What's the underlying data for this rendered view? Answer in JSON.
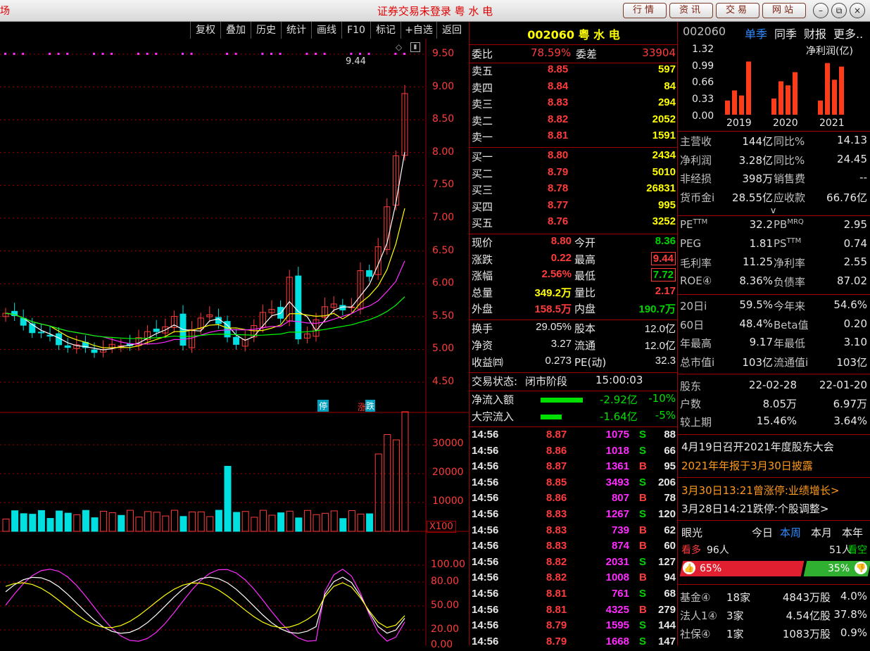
{
  "titlebar": {
    "left_fragment": "场",
    "title": "证券交易未登录 粤 水 电",
    "buttons": [
      "行情",
      "资讯",
      "交易",
      "网站"
    ],
    "win_min": "–",
    "win_restore": "⧉",
    "win_close": "×"
  },
  "toolbar": {
    "items": [
      "复权",
      "叠加",
      "历史",
      "统计",
      "画线",
      "F10",
      "标记",
      "+自选",
      "返回"
    ]
  },
  "kline": {
    "price_axis": [
      "9.50",
      "9.00",
      "8.50",
      "8.00",
      "7.50",
      "7.00",
      "6.50",
      "6.00",
      "5.50",
      "5.00",
      "4.50"
    ],
    "high_label": "9.44",
    "badge_stop": "停",
    "badge_limit_down": "跌"
  },
  "volume": {
    "axis": [
      "30000",
      "20000",
      "10000"
    ],
    "unit": "X100"
  },
  "indicator": {
    "axis": [
      "100.00",
      "80.00",
      "50.00",
      "20.00",
      "0.00"
    ]
  },
  "quote": {
    "code": "002060",
    "name": "粤 水 电",
    "weibi_label": "委比",
    "weibi": "78.59%",
    "weicha_label": "委差",
    "weicha": "33904",
    "sell": [
      {
        "label": "卖五",
        "price": "8.85",
        "vol": "597"
      },
      {
        "label": "卖四",
        "price": "8.84",
        "vol": "84"
      },
      {
        "label": "卖三",
        "price": "8.83",
        "vol": "294"
      },
      {
        "label": "卖二",
        "price": "8.82",
        "vol": "2052"
      },
      {
        "label": "卖一",
        "price": "8.81",
        "vol": "1591"
      }
    ],
    "buy": [
      {
        "label": "买一",
        "price": "8.80",
        "vol": "2434"
      },
      {
        "label": "买二",
        "price": "8.79",
        "vol": "5010"
      },
      {
        "label": "买三",
        "price": "8.78",
        "vol": "26831"
      },
      {
        "label": "买四",
        "price": "8.77",
        "vol": "995"
      },
      {
        "label": "买五",
        "price": "8.76",
        "vol": "3252"
      }
    ],
    "stats": [
      {
        "l1": "现价",
        "v1": "8.80",
        "l2": "今开",
        "v2": "8.36",
        "c1": "red",
        "c2": "green",
        "box": false
      },
      {
        "l1": "涨跌",
        "v1": "0.22",
        "l2": "最高",
        "v2": "9.44",
        "c1": "red",
        "c2": "red",
        "box": true
      },
      {
        "l1": "涨幅",
        "v1": "2.56%",
        "l2": "最低",
        "v2": "7.72",
        "c1": "red",
        "c2": "green",
        "box": true
      },
      {
        "l1": "总量",
        "v1": "349.2万",
        "l2": "量比",
        "v2": "2.17",
        "c1": "yellow",
        "c2": "red",
        "box": false
      },
      {
        "l1": "外盘",
        "v1": "158.5万",
        "l2": "内盘",
        "v2": "190.7万",
        "c1": "red",
        "c2": "green",
        "box": false
      }
    ],
    "stats2": [
      {
        "l1": "换手",
        "v1": "29.05%",
        "l2": "股本",
        "v2": "12.0亿"
      },
      {
        "l1": "净资",
        "v1": "3.27",
        "l2": "流通",
        "v2": "12.0亿"
      },
      {
        "l1": "收益㈣",
        "v1": "0.273",
        "l2": "PE(动)",
        "v2": "32.3"
      }
    ],
    "status_label": "交易状态:",
    "status": "闭市阶段",
    "status_time": "15:00:03",
    "flow": [
      {
        "label": "净流入额",
        "value": "-2.92亿",
        "pct": "-10%",
        "bar": 0.1
      },
      {
        "label": "大宗流入",
        "value": "-1.64亿",
        "pct": "-5%",
        "bar": 0.05
      }
    ],
    "ticks": [
      {
        "t": "14:56",
        "p": "8.87",
        "v": "1075",
        "d": "S",
        "n": "88"
      },
      {
        "t": "14:56",
        "p": "8.86",
        "v": "1018",
        "d": "S",
        "n": "66"
      },
      {
        "t": "14:56",
        "p": "8.87",
        "v": "1361",
        "d": "B",
        "n": "95"
      },
      {
        "t": "14:56",
        "p": "8.85",
        "v": "3493",
        "d": "S",
        "n": "206"
      },
      {
        "t": "14:56",
        "p": "8.86",
        "v": "807",
        "d": "B",
        "n": "78"
      },
      {
        "t": "14:56",
        "p": "8.83",
        "v": "1267",
        "d": "S",
        "n": "120"
      },
      {
        "t": "14:56",
        "p": "8.83",
        "v": "739",
        "d": "B",
        "n": "62"
      },
      {
        "t": "14:56",
        "p": "8.83",
        "v": "874",
        "d": "B",
        "n": "60"
      },
      {
        "t": "14:56",
        "p": "8.82",
        "v": "2031",
        "d": "S",
        "n": "127"
      },
      {
        "t": "14:56",
        "p": "8.82",
        "v": "1008",
        "d": "B",
        "n": "94"
      },
      {
        "t": "14:56",
        "p": "8.81",
        "v": "761",
        "d": "S",
        "n": "68"
      },
      {
        "t": "14:56",
        "p": "8.81",
        "v": "4325",
        "d": "B",
        "n": "279"
      },
      {
        "t": "14:56",
        "p": "8.79",
        "v": "1595",
        "d": "S",
        "n": "144"
      },
      {
        "t": "14:56",
        "p": "8.79",
        "v": "1668",
        "d": "S",
        "n": "147"
      }
    ]
  },
  "finance": {
    "code": "002060",
    "tabs": [
      "单季",
      "同季",
      "财报",
      "更多.."
    ],
    "chart_title": "净利润(亿)",
    "chart_axis": [
      "1.32",
      "0.99",
      "0.66",
      "0.33",
      "0.00"
    ],
    "chart_years": [
      "2019",
      "2020",
      "2021"
    ],
    "rows": [
      {
        "l1": "主营收",
        "v1": "144亿",
        "l2": "同比%",
        "v2": "14.13"
      },
      {
        "l1": "净利润",
        "v1": "3.28亿",
        "l2": "同比%",
        "v2": "24.45"
      },
      {
        "l1": "非经损",
        "v1": "398万",
        "l2": "销售费",
        "v2": "--"
      },
      {
        "l1": "货币金i",
        "v1": "28.55亿",
        "l2": "应收款",
        "v2": "66.76亿"
      }
    ],
    "expand": "v",
    "val_rows": [
      {
        "l1": "PE",
        "s1": "TTM",
        "v1": "32.2",
        "l2": "PB",
        "s2": "MRQ",
        "v2": "2.95"
      },
      {
        "l1": "PEG",
        "s1": "",
        "v1": "1.81",
        "l2": "PS",
        "s2": "TTM",
        "v2": "0.74"
      },
      {
        "l1": "毛利率",
        "s1": "",
        "v1": "11.25",
        "l2": "净利率",
        "s2": "",
        "v2": "2.55"
      },
      {
        "l1": "ROE④",
        "s1": "",
        "v1": "8.36%",
        "l2": "负债率",
        "s2": "",
        "v2": "87.02"
      }
    ],
    "perf_rows": [
      {
        "l1": "20日i",
        "v1": "59.5%",
        "l2": "今年来",
        "v2": "54.6%"
      },
      {
        "l1": "60日",
        "v1": "48.4%",
        "l2": "Beta值",
        "v2": "0.20"
      },
      {
        "l1": "年最高",
        "v1": "9.17",
        "l2": "年最低",
        "v2": "3.10"
      },
      {
        "l1": "总市值i",
        "v1": "103亿",
        "l2": "流通值i",
        "v2": "103亿"
      }
    ],
    "holders": {
      "label": "股东",
      "d1": "22-02-28",
      "d2": "22-01-20",
      "rows": [
        {
          "l": "户数",
          "v1": "8.05万",
          "v2": "6.97万"
        },
        {
          "l": "较上期",
          "v1": "15.46%",
          "v2": "3.64%"
        }
      ]
    },
    "news": [
      {
        "text": "4月19日召开2021年度股东大会",
        "color": "white"
      },
      {
        "text": "2021年年报于3月30日披露",
        "color": "orange"
      },
      {
        "text": "3月30日13:21曾涨停:业绩增长>",
        "color": "orange"
      },
      {
        "text": "3月28日14:21跌停:个股调整>",
        "color": "white"
      }
    ],
    "eyes": {
      "label": "眼光",
      "tabs": [
        "今日",
        "本周",
        "本月",
        "本年"
      ],
      "bull_label": "看多",
      "bull_count": "96人",
      "bear_count": "51人",
      "bear_label": "看空",
      "bull_pct": "65%",
      "bear_pct": "35%",
      "bull_frac": 0.65
    },
    "inst": [
      {
        "l": "基金④",
        "n": "18家",
        "v": "4843万股",
        "p": "4.0%"
      },
      {
        "l": "法人1④",
        "n": "3家",
        "v": "4.54亿股",
        "p": "37.8%"
      },
      {
        "l": "社保④",
        "n": "1家",
        "v": "1083万股",
        "p": "0.9%"
      }
    ]
  },
  "colors": {
    "up": "#ff3c3c",
    "down": "#00e0e0",
    "ma5": "#ffffff",
    "ma10": "#ffff00",
    "ma20": "#ff2cff",
    "ma60": "#00ff00",
    "grid": "#a00000"
  }
}
